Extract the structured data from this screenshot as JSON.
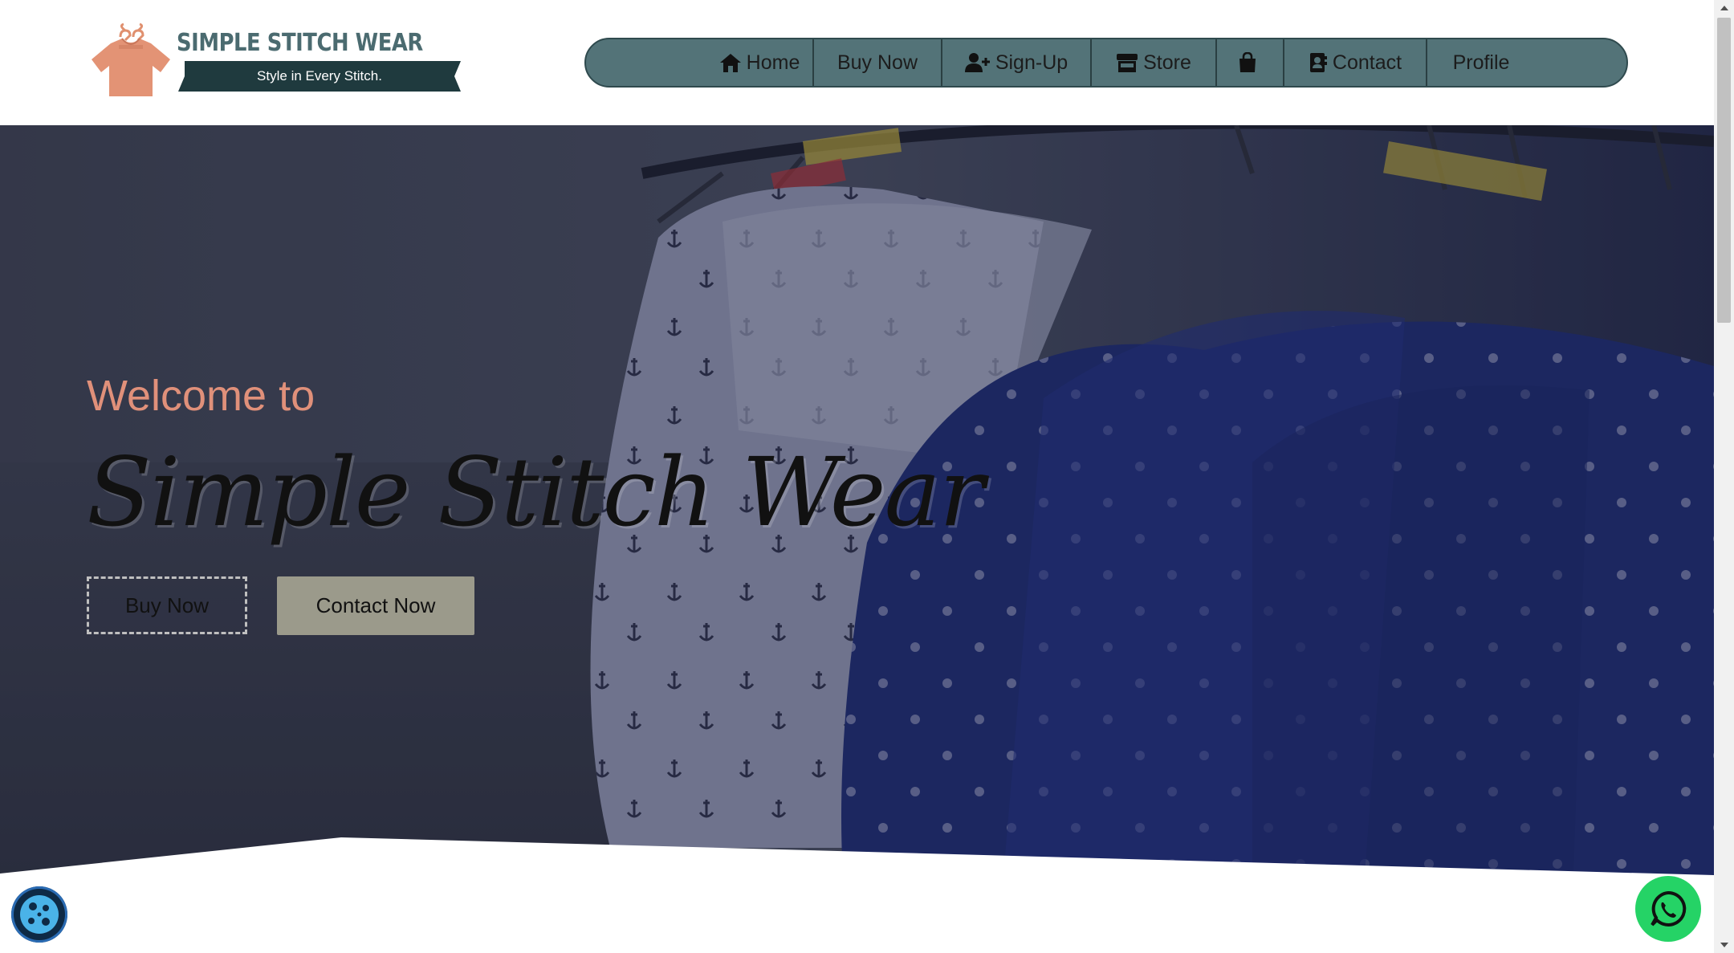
{
  "brand": {
    "name": "SIMPLE STITCH WEAR",
    "tagline": "Style in Every Stitch."
  },
  "nav": {
    "items": [
      {
        "label": "Home",
        "icon": "home-icon"
      },
      {
        "label": "Buy Now",
        "icon": ""
      },
      {
        "label": "Sign-Up",
        "icon": "user-plus-icon"
      },
      {
        "label": "Store",
        "icon": "store-icon"
      },
      {
        "label": "",
        "icon": "shopping-bag-icon"
      },
      {
        "label": "Contact",
        "icon": "address-book-icon"
      },
      {
        "label": "Profile",
        "icon": ""
      }
    ]
  },
  "hero": {
    "welcome": "Welcome to",
    "title": "Simple Stitch Wear",
    "buy_button": "Buy Now",
    "contact_button": "Contact Now"
  },
  "widgets": {
    "cookie_icon": "cookie-icon",
    "whatsapp_icon": "whatsapp-icon"
  },
  "colors": {
    "accent": "#e0907a",
    "nav_bg": "#537378",
    "brand_text": "#4b6b70",
    "contact_button": "#9b9a8b",
    "whatsapp": "#25d366"
  }
}
